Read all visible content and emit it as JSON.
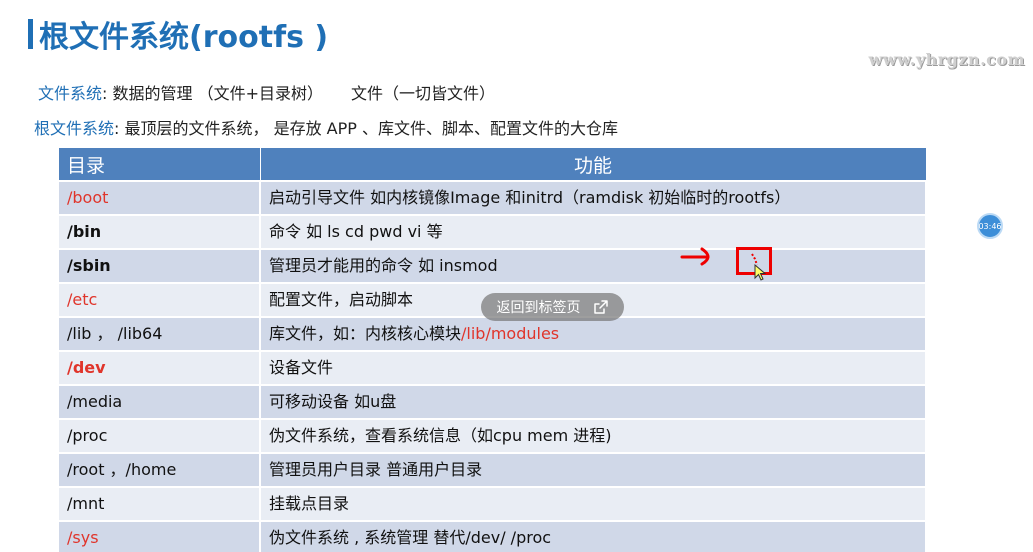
{
  "title": "根文件系统(rootfs  )",
  "watermark": "www.yhrgzn.com",
  "intro": {
    "line1_key": "文件系统",
    "line1_rest": ":  数据的管理 （文件+目录树）",
    "line1_extra": "文件（一切皆文件）",
    "line2_key": "根文件系统",
    "line2_rest": ":  最顶层的文件系统，  是存放 APP 、库文件、脚本、配置文件的大仓库"
  },
  "table": {
    "headers": [
      "目录",
      "功能"
    ],
    "rows": [
      {
        "dir": "/boot",
        "func": "启动引导文件  如内核镜像Image   和initrd（ramdisk 初始临时的rootfs）",
        "style": "red"
      },
      {
        "dir": "/bin",
        "func": "命令  如   ls  cd   pwd   vi   等",
        "style": "bold"
      },
      {
        "dir": "/sbin",
        "func": "管理员才能用的命令  如 insmod",
        "style": "bold"
      },
      {
        "dir": "/etc",
        "func": "配置文件，启动脚本",
        "style": "red"
      },
      {
        "dir": "/lib   ，  /lib64",
        "func": "库文件，如：内核核心模块",
        "func_highlight": "/lib/modules",
        "style": "plain"
      },
      {
        "dir": "/dev",
        "func": "设备文件",
        "style": "redbold"
      },
      {
        "dir": "/media",
        "func": "可移动设备  如u盘",
        "style": "plain"
      },
      {
        "dir": "/proc",
        "func": "伪文件系统，查看系统信息（如cpu   mem   进程)",
        "style": "plain"
      },
      {
        "dir": "/root   ，/home",
        "func": "管理员用户目录        普通用户目录",
        "style": "plain"
      },
      {
        "dir": "/mnt",
        "func": "挂载点目录",
        "style": "plain"
      },
      {
        "dir": "/sys",
        "func": "伪文件系统 , 系统管理  替代/dev/  /proc",
        "style": "red"
      }
    ]
  },
  "overlay": {
    "back_button_label": "返回到标签页",
    "timer": "03:46"
  },
  "colors": {
    "title_blue": "#1f6fb5",
    "header_blue": "#4f81bd",
    "row_odd": "#d0d8e8",
    "row_even": "#e9edf4",
    "accent_red": "#e0352b"
  }
}
